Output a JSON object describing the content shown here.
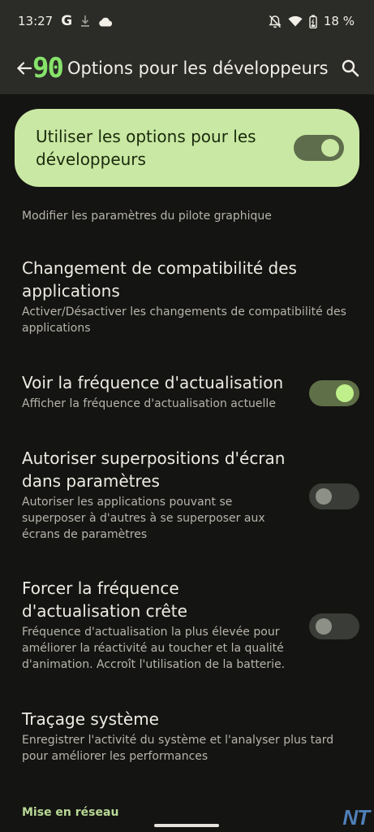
{
  "status": {
    "time": "13:27",
    "g_glyph": "G",
    "battery": "18 %"
  },
  "app_bar": {
    "overlay_fps": "90",
    "title": "Options pour les développeurs"
  },
  "master": {
    "label": "Utiliser les options pour les développeurs",
    "enabled": true
  },
  "prefs": [
    {
      "title": "",
      "summary": "Modifier les paramètres du pilote graphique"
    },
    {
      "title": "Changement de compatibilité des applications",
      "summary": "Activer/Désactiver les changements de compatibilité des applications"
    },
    {
      "title": "Voir la fréquence d'actualisation",
      "summary": "Afficher la fréquence d'actualisation actuelle",
      "enabled": true
    },
    {
      "title": "Autoriser superpositions d'écran dans paramètres",
      "summary": "Autoriser les applications pouvant se superposer à d'autres à se superposer aux écrans de paramètres",
      "enabled": false
    },
    {
      "title": "Forcer la fréquence d'actualisation crête",
      "summary": "Fréquence d'actualisation la plus élevée pour améliorer la réactivité au toucher et la qualité d'animation. Accroît l'utilisation de la batterie.",
      "enabled": false
    },
    {
      "title": "Traçage système",
      "summary": "Enregistrer l'activité du système et l'analyser plus tard pour améliorer les performances"
    }
  ],
  "section_network": "Mise en réseau",
  "watermark": "NT",
  "colors": {
    "accent": "#c9e8a3",
    "switch_on_thumb": "#bff08b",
    "fps_overlay": "#86e36a",
    "section_header": "#b9d996"
  }
}
